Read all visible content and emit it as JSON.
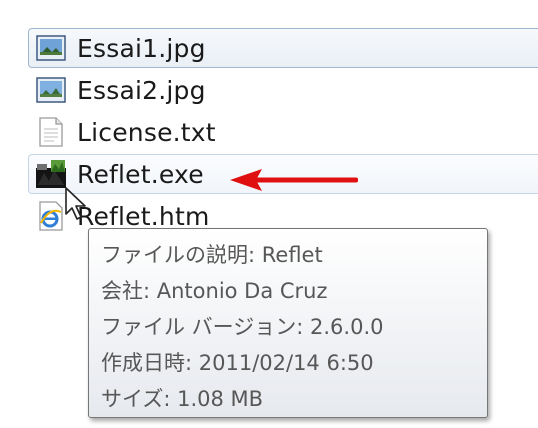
{
  "files": [
    {
      "name": "Essai1.jpg",
      "icon": "image-file-icon"
    },
    {
      "name": "Essai2.jpg",
      "icon": "image-file-icon"
    },
    {
      "name": "License.txt",
      "icon": "text-file-icon"
    },
    {
      "name": "Reflet.exe",
      "icon": "reflet-app-icon"
    },
    {
      "name": "Reflet.htm",
      "icon": "ie-html-file-icon"
    }
  ],
  "tooltip": {
    "description": "ファイルの説明: Reflet",
    "company": "会社: Antonio Da Cruz",
    "version": "ファイル バージョン: 2.6.0.0",
    "created": "作成日時: 2011/02/14 6:50",
    "size": "サイズ: 1.08 MB"
  },
  "colors": {
    "arrow": "#e01010",
    "selection_border": "#9fb6cf",
    "tooltip_text": "#575757"
  }
}
